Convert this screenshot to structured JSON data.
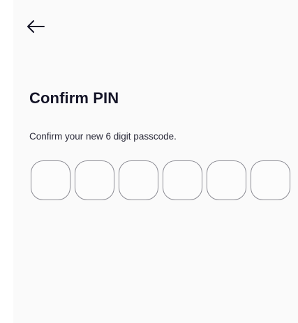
{
  "header": {
    "back_icon": "arrow-left-icon"
  },
  "main": {
    "title": "Confirm PIN",
    "subtitle": "Confirm your new 6 digit passcode.",
    "pin": {
      "length": 6,
      "digits": [
        "",
        "",
        "",
        "",
        "",
        ""
      ]
    }
  },
  "colors": {
    "background": "#fafafa",
    "title": "#151528",
    "box_border": "#8c8c94"
  }
}
